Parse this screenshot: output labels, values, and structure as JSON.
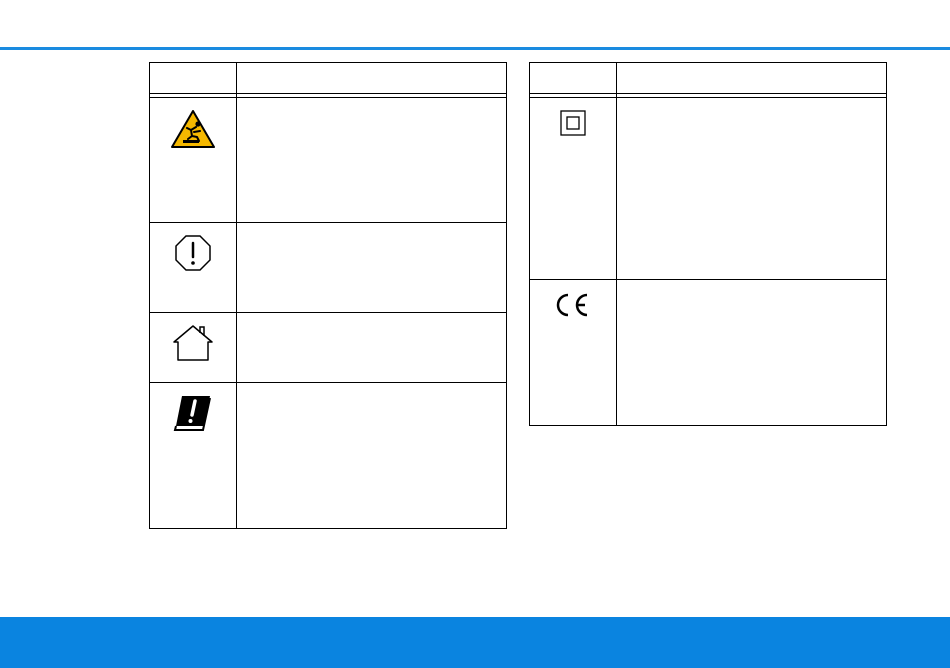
{
  "header": {
    "rule_color": "#1a8be0"
  },
  "footer": {
    "band_color": "#0a84e0"
  },
  "left_table": {
    "header": {
      "symbol": "",
      "meaning": ""
    },
    "rows": [
      {
        "icon": "trip-hazard-warning-icon",
        "text": ""
      },
      {
        "icon": "stop-exclamation-icon",
        "text": ""
      },
      {
        "icon": "indoor-use-house-icon",
        "text": ""
      },
      {
        "icon": "read-manual-icon",
        "text": ""
      }
    ]
  },
  "right_table": {
    "header": {
      "symbol": "",
      "meaning": ""
    },
    "rows": [
      {
        "icon": "protection-class-ii-icon",
        "text": ""
      },
      {
        "icon": "ce-mark-icon",
        "text": ""
      }
    ]
  },
  "colors": {
    "warning_yellow": "#f5b800",
    "line": "#000000"
  }
}
